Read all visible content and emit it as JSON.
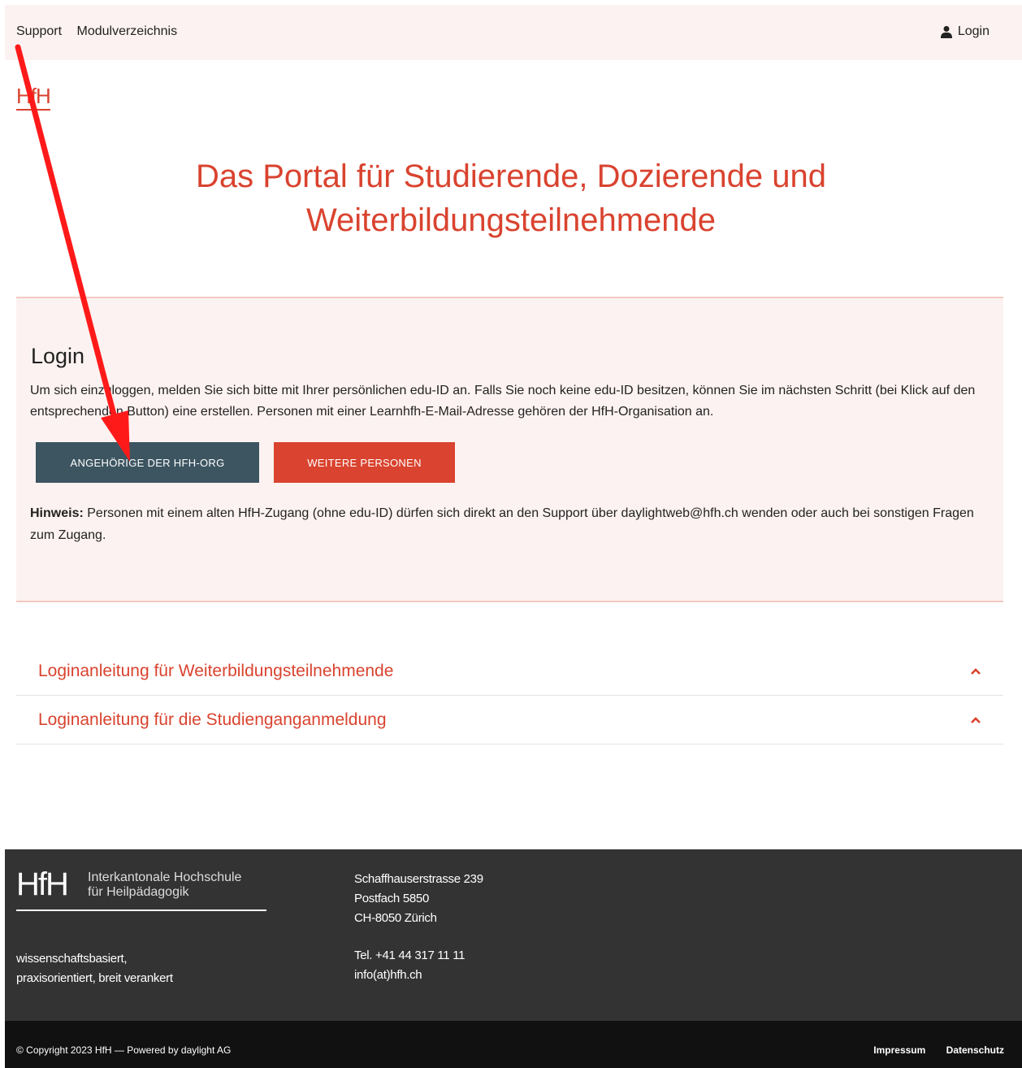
{
  "topbar": {
    "nav": [
      "Support",
      "Modulverzeichnis"
    ],
    "login_label": "Login"
  },
  "logo_small": "HfH",
  "hero": {
    "line1": "Das Portal für Studierende, Dozierende und",
    "line2": "Weiterbildungsteilnehmende"
  },
  "login": {
    "heading": "Login",
    "text": "Um sich einzuloggen, melden Sie sich bitte mit Ihrer persönlichen edu-ID an. Falls Sie noch keine edu-ID besitzen, können Sie im nächsten Schritt (bei Klick auf den entsprechenden Button) eine erstellen. Personen mit einer Learnhfh-E-Mail-Adresse gehören der HfH-Organisation an.",
    "btn_org": "ANGEHÖRIGE DER HFH-ORG",
    "btn_other": "WEITERE PERSONEN",
    "hint_label": "Hinweis:",
    "hint_text": " Personen mit einem alten HfH-Zugang (ohne edu-ID) dürfen sich direkt an den Support über daylightweb@hfh.ch wenden oder auch bei sonstigen Fragen zum Zugang."
  },
  "accordion": [
    {
      "label": "Loginanleitung für Weiterbildungsteilnehmende"
    },
    {
      "label": "Loginanleitung für die Studienganganmeldung"
    }
  ],
  "footer": {
    "logo_mark": "HfH",
    "logo_name_1": "Interkantonale Hochschule",
    "logo_name_2": "für Heilpädagogik",
    "tagline_1": "wissenschaftsbasiert,",
    "tagline_2": "praxisorientiert, breit verankert",
    "address_1": "Schaffhauserstrasse 239",
    "address_2": "Postfach 5850",
    "address_3": "CH-8050 Zürich",
    "tel": "Tel. +41 44 317 11 11",
    "email": "info(at)hfh.ch"
  },
  "bottombar": {
    "copyright": "© Copyright 2023 HfH — Powered by daylight AG",
    "impressum": "Impressum",
    "datenschutz": "Datenschutz"
  },
  "colors": {
    "accent": "#d9432f",
    "org_button": "#3c5561",
    "panel_bg": "#fcf2f1",
    "footer_bg": "#333333",
    "annotation_arrow": "#ff0000"
  }
}
